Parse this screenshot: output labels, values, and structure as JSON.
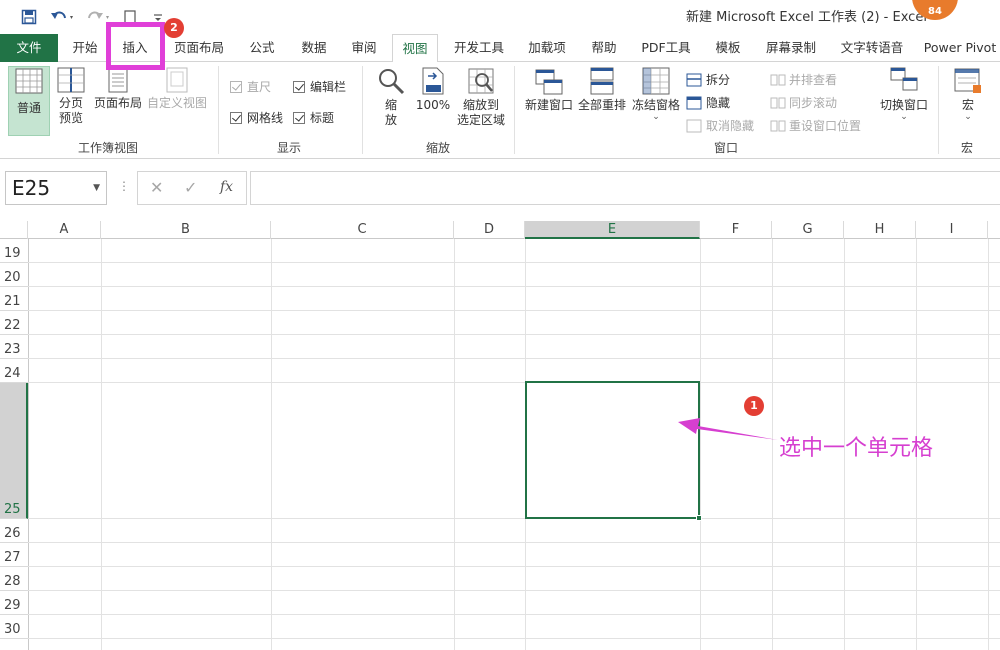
{
  "window": {
    "title": "新建 Microsoft Excel 工作表 (2)  -  Excel",
    "account_level": "84"
  },
  "quick_access": {
    "icons": [
      "save-icon",
      "undo-icon",
      "redo-icon",
      "touch-mode-icon",
      "customize-icon"
    ]
  },
  "tabs": [
    {
      "key": "file",
      "label": "文件"
    },
    {
      "key": "home",
      "label": "开始"
    },
    {
      "key": "insert",
      "label": "插入"
    },
    {
      "key": "layout",
      "label": "页面布局"
    },
    {
      "key": "formulas",
      "label": "公式"
    },
    {
      "key": "data",
      "label": "数据"
    },
    {
      "key": "review",
      "label": "审阅"
    },
    {
      "key": "view",
      "label": "视图",
      "active": true
    },
    {
      "key": "developer",
      "label": "开发工具"
    },
    {
      "key": "addins",
      "label": "加载项"
    },
    {
      "key": "help",
      "label": "帮助"
    },
    {
      "key": "pdf",
      "label": "PDF工具"
    },
    {
      "key": "template",
      "label": "模板"
    },
    {
      "key": "record",
      "label": "屏幕录制"
    },
    {
      "key": "tts",
      "label": "文字转语音"
    },
    {
      "key": "powerpivot",
      "label": "Power Pivot"
    }
  ],
  "ribbon": {
    "workbook_views": {
      "label": "工作簿视图",
      "normal": "普通",
      "page_break_line1": "分页",
      "page_break_line2": "预览",
      "page_layout": "页面布局",
      "custom_views": "自定义视图"
    },
    "show": {
      "label": "显示",
      "ruler": "直尺",
      "formula_bar": "编辑栏",
      "gridlines": "网格线",
      "headings": "标题"
    },
    "zoom": {
      "label": "缩放",
      "zoom_line1": "缩",
      "zoom_line2": "放",
      "zoom100": "100%",
      "zoom_sel_line1": "缩放到",
      "zoom_sel_line2": "选定区域"
    },
    "window": {
      "label": "窗口",
      "new_window": "新建窗口",
      "arrange_all": "全部重排",
      "freeze_panes": "冻结窗格",
      "split": "拆分",
      "hide": "隐藏",
      "unhide": "取消隐藏",
      "side_by_side": "并排查看",
      "sync_scroll": "同步滚动",
      "reset_position": "重设窗口位置",
      "switch_windows": "切换窗口"
    },
    "macros": {
      "label": "宏",
      "macros": "宏"
    }
  },
  "formula_bar": {
    "name_box": "E25",
    "fx": "fx",
    "value": ""
  },
  "sheet": {
    "columns": [
      "A",
      "B",
      "C",
      "D",
      "E",
      "F",
      "G",
      "H",
      "I"
    ],
    "selected_column": "E",
    "rows": [
      "19",
      "20",
      "21",
      "22",
      "23",
      "24",
      "25",
      "26",
      "27",
      "28",
      "29",
      "30"
    ],
    "selected_row": "25"
  },
  "annotations": {
    "badge1": "1",
    "badge2": "2",
    "callout": "选中一个单元格",
    "highlight_color": "#e03fd8"
  },
  "colors": {
    "excel_green": "#217346",
    "badge_red": "#e33e33"
  }
}
